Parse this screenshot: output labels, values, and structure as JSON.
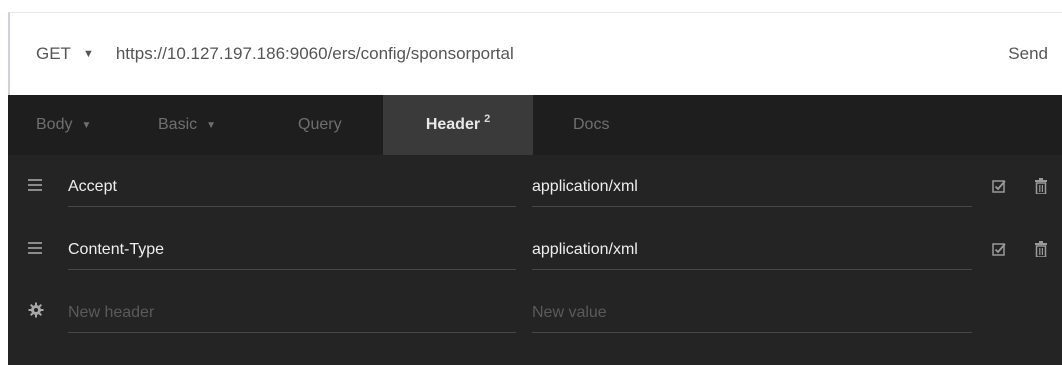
{
  "request": {
    "method": "GET",
    "url": "https://10.127.197.186:9060/ers/config/sponsorportal",
    "send_label": "Send"
  },
  "tabs": [
    {
      "label": "Body",
      "has_dropdown": true
    },
    {
      "label": "Basic",
      "has_dropdown": true
    },
    {
      "label": "Query",
      "has_dropdown": false
    },
    {
      "label": "Header",
      "badge": "2",
      "active": true
    },
    {
      "label": "Docs",
      "has_dropdown": false
    }
  ],
  "headers": [
    {
      "name": "Accept",
      "value": "application/xml",
      "enabled": true
    },
    {
      "name": "Content-Type",
      "value": "application/xml",
      "enabled": true
    }
  ],
  "new_header": {
    "name_placeholder": "New header",
    "value_placeholder": "New value"
  },
  "icons": {
    "method_dropdown": "caret-down-icon",
    "row_handle": "drag-handle-icon",
    "new_row": "gear-icon",
    "enabled": "checkbox-checked-icon",
    "delete": "trash-icon"
  },
  "colors": {
    "panel_bg": "#242424",
    "tabbar_bg": "#1e1e1e",
    "active_tab_bg": "#3a3a3a"
  }
}
